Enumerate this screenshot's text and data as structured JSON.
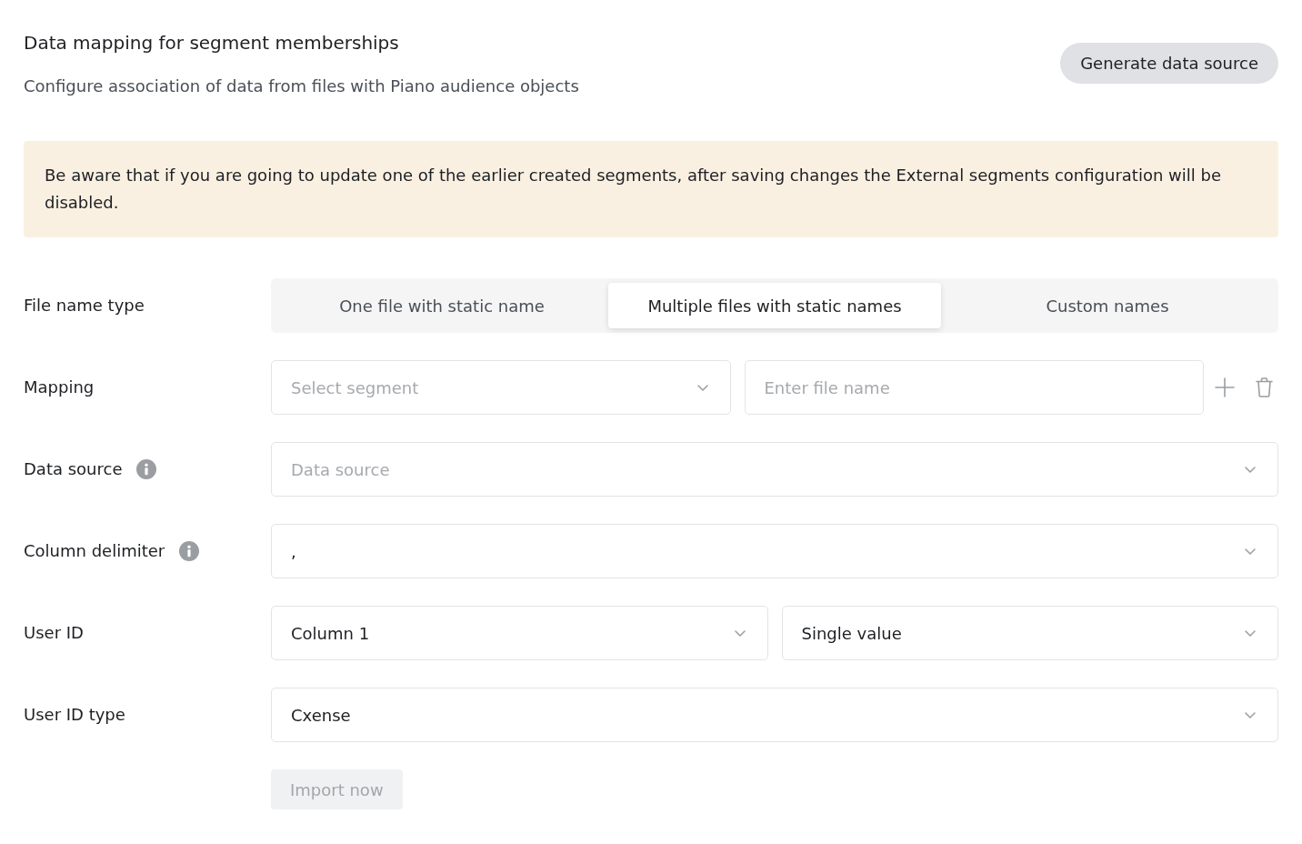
{
  "header": {
    "title": "Data mapping for segment memberships",
    "subtitle": "Configure association of data from files with Piano audience objects",
    "action_button": "Generate data source"
  },
  "alert": {
    "text": "Be aware that if you are going to update one of the earlier created segments, after saving changes the External segments configuration will be disabled."
  },
  "form": {
    "rows": [
      {
        "kind": "segmented",
        "label": "File name type",
        "info": false,
        "options": [
          {
            "label": "One file with static name",
            "selected": false
          },
          {
            "label": "Multiple files with static names",
            "selected": true
          },
          {
            "label": "Custom names",
            "selected": false
          }
        ]
      },
      {
        "kind": "mapping",
        "label": "Mapping",
        "info": false,
        "fields": [
          {
            "kind": "select",
            "placeholder": "Select segment"
          },
          {
            "kind": "input",
            "placeholder": "Enter file name"
          }
        ]
      },
      {
        "kind": "fields",
        "label": "Data source",
        "info": true,
        "fields": [
          {
            "kind": "select",
            "placeholder": "Data source"
          }
        ]
      },
      {
        "kind": "fields",
        "label": "Column delimiter",
        "info": true,
        "fields": [
          {
            "kind": "select",
            "value": ","
          }
        ]
      },
      {
        "kind": "fields",
        "label": "User ID",
        "info": false,
        "fields": [
          {
            "kind": "select",
            "value": "Column 1"
          },
          {
            "kind": "select",
            "value": "Single value"
          }
        ]
      },
      {
        "kind": "fields",
        "label": "User ID type",
        "info": false,
        "fields": [
          {
            "kind": "select",
            "value": "Cxense"
          }
        ]
      }
    ]
  },
  "import_button": {
    "label": "Import now",
    "disabled": true
  }
}
